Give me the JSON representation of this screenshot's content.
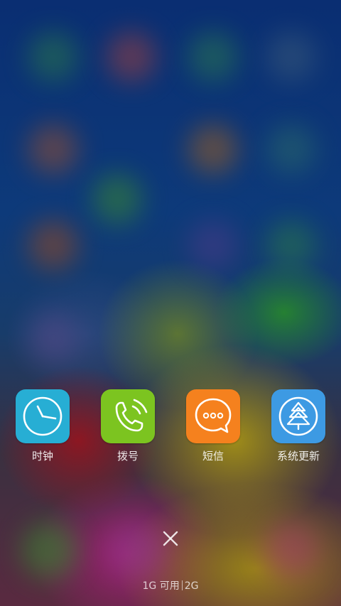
{
  "apps": [
    {
      "label": "时钟",
      "icon": "clock-icon",
      "color": "#27aed4"
    },
    {
      "label": "拨号",
      "icon": "phone-icon",
      "color": "#7cc420"
    },
    {
      "label": "短信",
      "icon": "message-icon",
      "color": "#f5811e"
    },
    {
      "label": "系统更新",
      "icon": "update-tree-icon",
      "color": "#3d9ae3"
    }
  ],
  "memory": {
    "available": "1G 可用",
    "total": "2G"
  }
}
